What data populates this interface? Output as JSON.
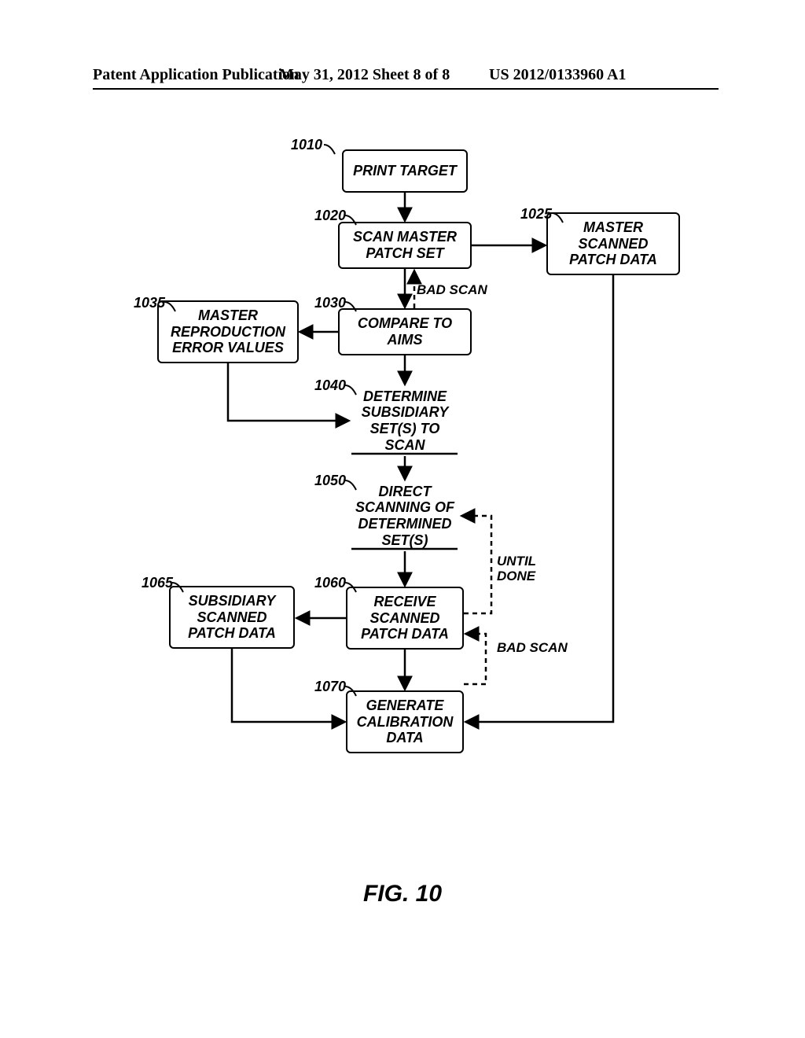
{
  "header": {
    "left": "Patent Application Publication",
    "center": "May 31, 2012  Sheet 8 of 8",
    "right": "US 2012/0133960 A1"
  },
  "refs": {
    "r1010": "1010",
    "r1020": "1020",
    "r1025": "1025",
    "r1030": "1030",
    "r1035": "1035",
    "r1040": "1040",
    "r1050": "1050",
    "r1060": "1060",
    "r1065": "1065",
    "r1070": "1070"
  },
  "boxes": {
    "b1010": "PRINT TARGET",
    "b1020": "SCAN MASTER\nPATCH SET",
    "b1025": "MASTER\nSCANNED\nPATCH DATA",
    "b1030": "COMPARE TO\nAIMS",
    "b1035": "MASTER\nREPRODUCTION\nERROR VALUES",
    "b1040": "DETERMINE\nSUBSIDIARY\nSET(S) TO\nSCAN",
    "b1050": "DIRECT\nSCANNING OF\nDETERMINED\nSET(S)",
    "b1060": "RECEIVE\nSCANNED\nPATCH DATA",
    "b1065": "SUBSIDIARY\nSCANNED\nPATCH DATA",
    "b1070": "GENERATE\nCALIBRATION\nDATA"
  },
  "annot": {
    "badscan1": "BAD SCAN",
    "untildone": "UNTIL\nDONE",
    "badscan2": "BAD SCAN"
  },
  "figure": "FIG. 10"
}
